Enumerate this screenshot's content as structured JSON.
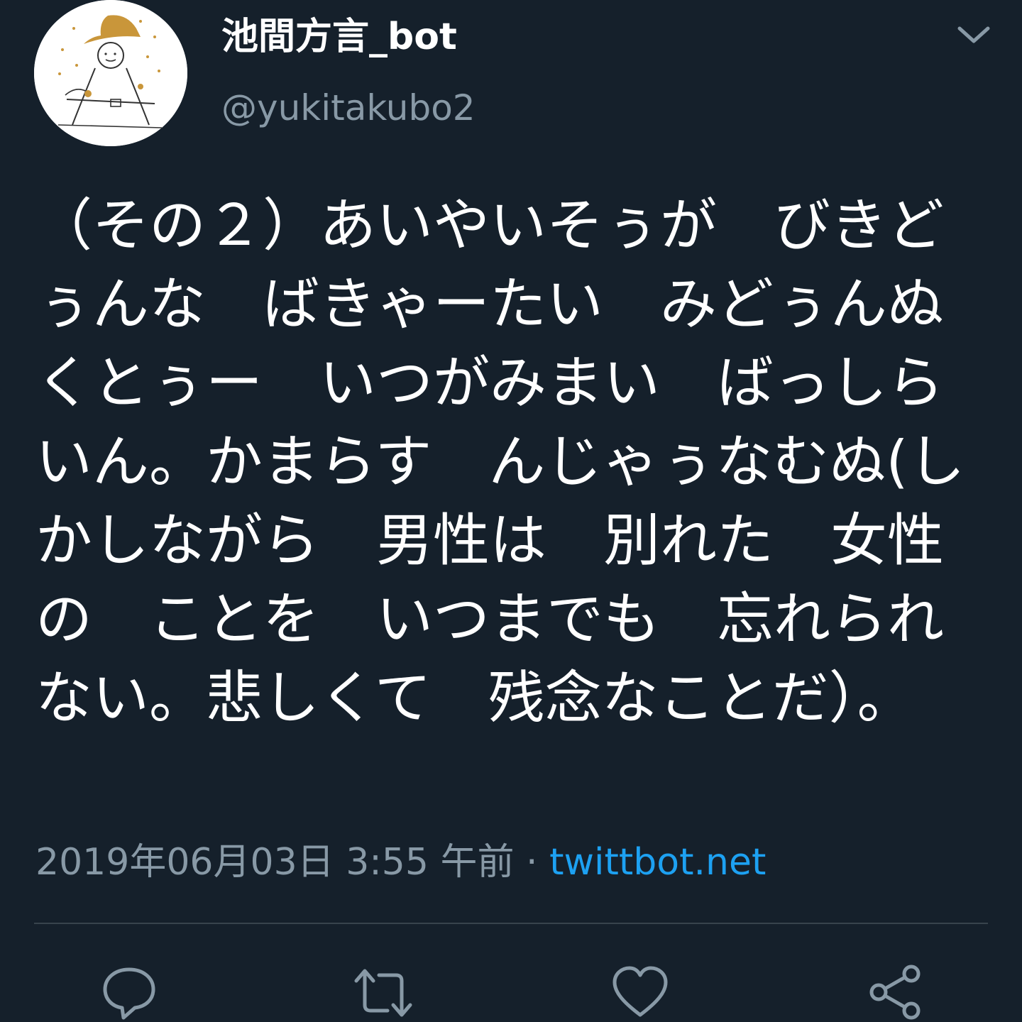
{
  "author": {
    "display_name": "池間方言_bot",
    "handle": "@yukitakubo2",
    "avatar_icon": "avatar-image"
  },
  "header": {
    "menu_icon": "chevron-down-icon"
  },
  "tweet": {
    "text": "（その２）あいやいそぅが　びきどぅんな　ばきゃーたい　みどぅんぬ　くとぅー　いつがみまい　ばっしらいん。かまらす　んじゃぅなむぬ(しかしながら　男性は　別れた　女性の　ことを　いつまでも　忘れられない。悲しくて　残念なことだ）。",
    "timestamp": "2019年06月03日 3:55 午前",
    "separator": " · ",
    "source": "twittbot.net"
  },
  "actions": {
    "reply_icon": "reply-icon",
    "retweet_icon": "retweet-icon",
    "like_icon": "heart-icon",
    "share_icon": "share-icon"
  },
  "colors": {
    "background": "#15202b",
    "text_primary": "#ffffff",
    "text_secondary": "#8899a6",
    "accent": "#1da1f2",
    "divider": "#38444d"
  }
}
